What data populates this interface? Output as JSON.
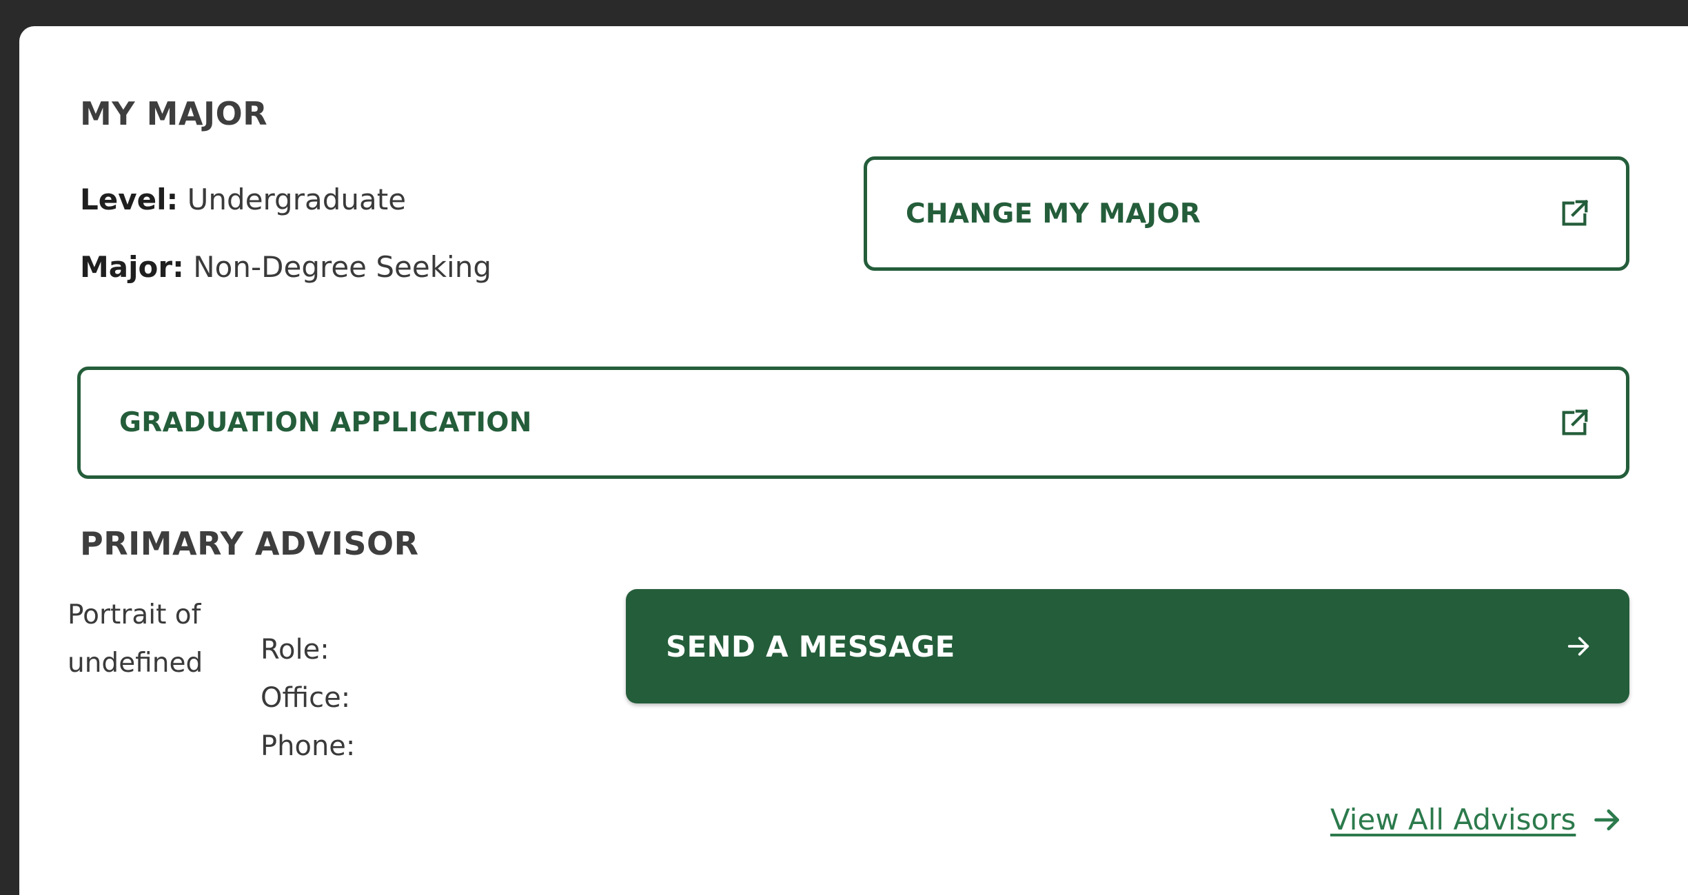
{
  "my_major": {
    "title": "MY MAJOR",
    "level_label": "Level:",
    "level_value": "Undergraduate",
    "major_label": "Major:",
    "major_value": "Non-Degree Seeking",
    "change_button_label": "CHANGE MY MAJOR",
    "change_button_icon": "external-link-icon"
  },
  "graduation": {
    "button_label": "GRADUATION APPLICATION",
    "button_icon": "external-link-icon"
  },
  "advisor": {
    "title": "PRIMARY ADVISOR",
    "portrait_alt": "Portrait of undefined",
    "role_label": "Role:",
    "office_label": "Office:",
    "phone_label": "Phone:",
    "send_button_label": "SEND A MESSAGE",
    "send_button_icon": "arrow-right-icon",
    "view_all_label": "View All Advisors",
    "view_all_icon": "arrow-right-icon"
  },
  "colors": {
    "brand_green": "#245d3a",
    "link_green": "#2c7a4c",
    "background": "#2a2a2a",
    "card": "#ffffff"
  }
}
